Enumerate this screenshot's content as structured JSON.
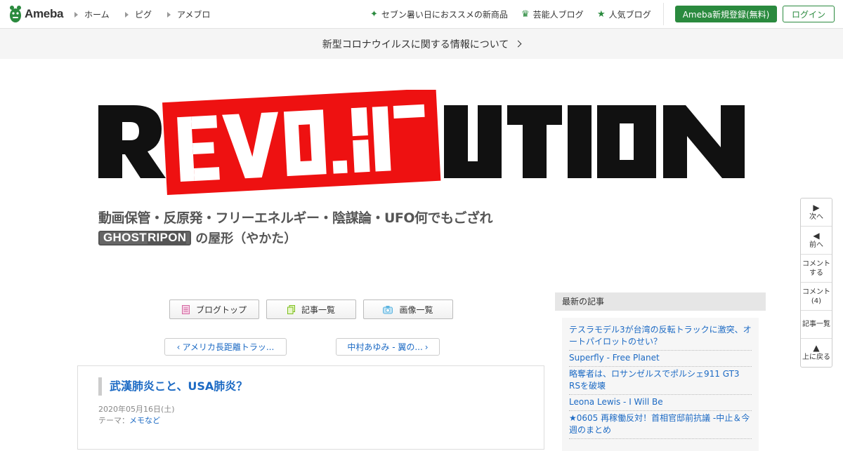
{
  "header": {
    "logo_text": "Ameba",
    "nav_left": [
      "ホーム",
      "ピグ",
      "アメブロ"
    ],
    "nav_right": [
      {
        "icon": "sparkle-icon",
        "label": "セブン暑い日におススメの新商品"
      },
      {
        "icon": "crown-icon",
        "label": "芸能人ブログ"
      },
      {
        "icon": "star-icon",
        "label": "人気ブログ"
      }
    ],
    "register_label": "Ameba新規登録(無料)",
    "login_label": "ログイン"
  },
  "notice": {
    "text": "新型コロナウイルスに関する情報について"
  },
  "banner": {
    "logo_text": "REVOLUTION",
    "tagline": "動画保管・反原発・フリーエネルギー・陰謀論・UFO何でもござれ",
    "ghost_a": "GHOST",
    "ghost_b": "RIPON",
    "ghost_suffix": "の屋形（やかた）"
  },
  "blog_nav": {
    "top": "ブログトップ",
    "list": "記事一覧",
    "images": "画像一覧"
  },
  "pager": {
    "prev": "アメリカ長距離トラッ...",
    "next": "中村あゆみ - 翼の..."
  },
  "article": {
    "title": "武漢肺炎こと、USA肺炎？",
    "date": "2020年05月16日(土)",
    "theme_label": "テーマ：",
    "theme": "メモなど"
  },
  "sidebar": {
    "heading": "最新の記事",
    "items": [
      "テスラモデル3が台湾の反転トラックに激突、オートパイロットのせい？",
      "Superfly - Free Planet",
      "略奪者は、ロサンゼルスでポルシェ911 GT3 RSを破壊",
      "Leona Lewis - I Will Be",
      "★0605 再稼働反対！首相官邸前抗議 -中止＆今週のまとめ"
    ]
  },
  "float_nav": {
    "next": "次へ",
    "prev": "前へ",
    "comment_line1": "コメント",
    "comment_line2": "する",
    "comments_line1": "コメント",
    "comments_count": "(4)",
    "list": "記事一覧",
    "top": "上に戻る"
  },
  "colors": {
    "brand_green": "#2a8a3e",
    "link_blue": "#1c6ac4",
    "banner_red": "#ee1111"
  }
}
